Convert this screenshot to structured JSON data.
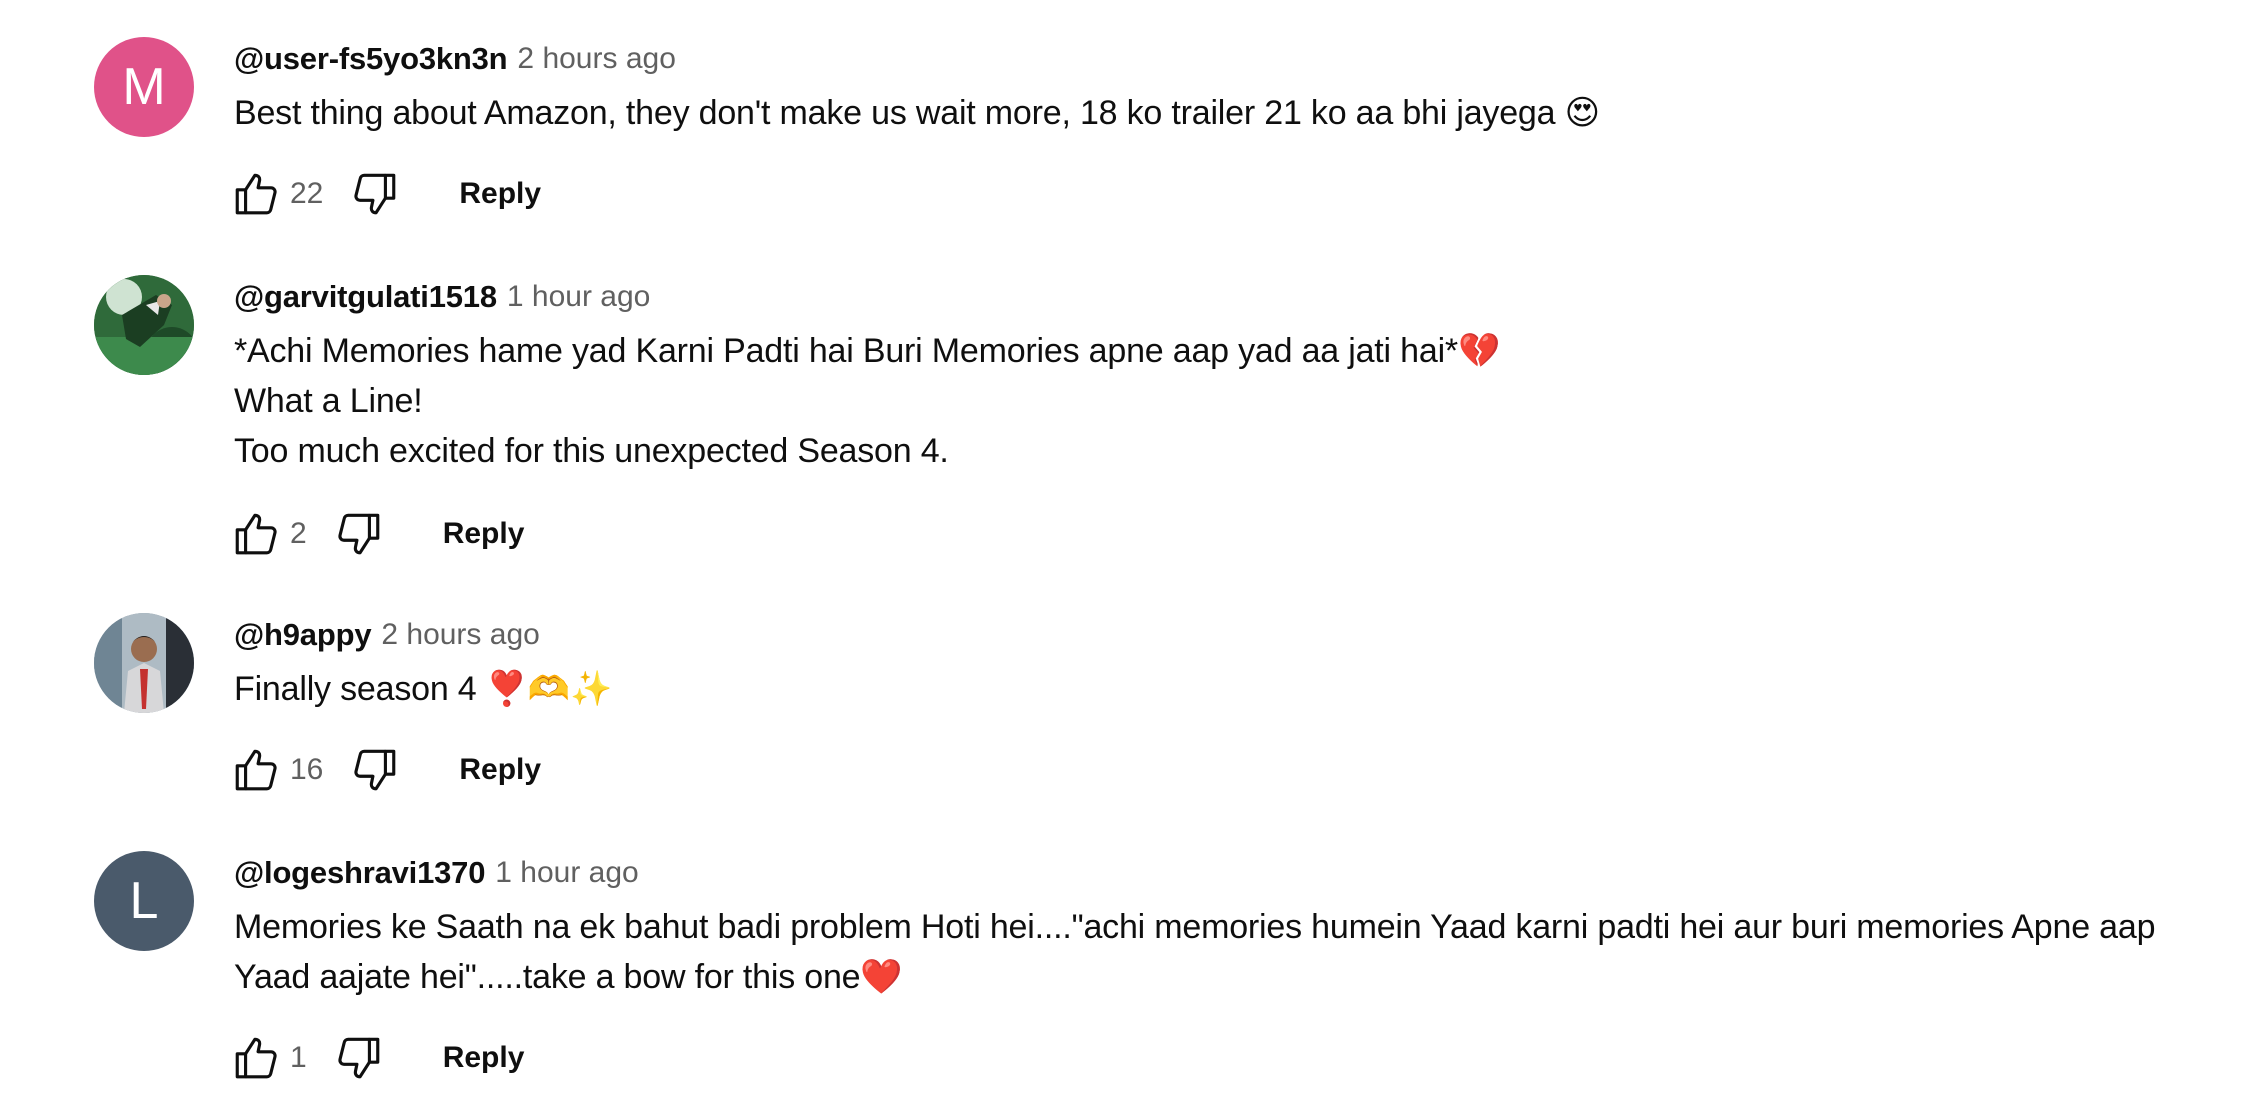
{
  "comments": [
    {
      "avatar": {
        "type": "letter",
        "letter": "M",
        "color": "#e05289"
      },
      "author": "@user-fs5yo3kn3n",
      "time": "2 hours ago",
      "lines": [
        "Best thing about Amazon, they don't make us wait more, 18 ko trailer 21 ko aa bhi jayega 😍"
      ],
      "likes": "22",
      "reply_label": "Reply"
    },
    {
      "avatar": {
        "type": "photo",
        "description_icon": "profile-photo-green"
      },
      "author": "@garvitgulati1518",
      "time": "1 hour ago",
      "lines": [
        "*Achi Memories hame yad Karni Padti hai Buri Memories apne aap yad aa jati hai*💔",
        "What a Line!",
        "Too much excited for this unexpected Season 4."
      ],
      "likes": "2",
      "reply_label": "Reply"
    },
    {
      "avatar": {
        "type": "photo",
        "description_icon": "profile-photo-man-suit"
      },
      "author": "@h9appy",
      "time": "2 hours ago",
      "lines": [
        "Finally season 4 ❣️🫶✨"
      ],
      "likes": "16",
      "reply_label": "Reply"
    },
    {
      "avatar": {
        "type": "letter",
        "letter": "L",
        "color": "#4a5a6b"
      },
      "author": "@logeshravi1370",
      "time": "1 hour ago",
      "lines": [
        "Memories ke Saath na ek bahut badi problem Hoti hei....\"achi memories humein Yaad karni padti hei aur buri memories Apne aap",
        "Yaad aajate hei\".....take a bow for this one❤️"
      ],
      "likes": "1",
      "reply_label": "Reply"
    }
  ]
}
